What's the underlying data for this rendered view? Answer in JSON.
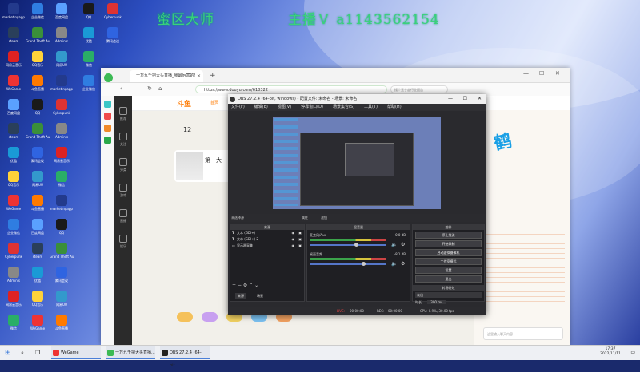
{
  "desktop": {
    "watermark_left": "蜜区大师",
    "watermark_right": "主播Ｖ a1143562154",
    "icons": [
      {
        "label": "marketingapp",
        "color": "#233a8c"
      },
      {
        "label": "企业微信",
        "color": "#2f7de1"
      },
      {
        "label": "百度网盘",
        "color": "#5aa0ff"
      },
      {
        "label": "QQ",
        "color": "#1a1a1a"
      },
      {
        "label": "Cyberpunk",
        "color": "#d33"
      },
      {
        "label": "steam",
        "color": "#2a3f5a"
      },
      {
        "label": "Grand Theft Auto V",
        "color": "#3a8f3a"
      },
      {
        "label": "Adminis",
        "color": "#888"
      },
      {
        "label": "优酷",
        "color": "#1a9ad6"
      },
      {
        "label": "腾讯会议",
        "color": "#2f64e1"
      },
      {
        "label": "网易云音乐",
        "color": "#d22"
      },
      {
        "label": "QQ音乐",
        "color": "#ffd23a"
      },
      {
        "label": "网易UU",
        "color": "#39c"
      },
      {
        "label": "微信",
        "color": "#2aae67"
      },
      {
        "label": "WeGame",
        "color": "#e33"
      },
      {
        "label": "斗鱼直播",
        "color": "#ff7a00"
      }
    ]
  },
  "browser": {
    "tab_title": "一万九千把大头直播_我最厉害的!",
    "url": "https://www.douyu.com/618322",
    "search_placeholder": "搜个元宇宙行业报告",
    "win_min": "—",
    "win_max": "☐",
    "win_close": "✕",
    "new_tab": "+",
    "nav_back": "‹",
    "nav_refresh": "↻",
    "nav_home": "⌂"
  },
  "douyu": {
    "logo": "斗鱼",
    "nav_home": "首页",
    "left_items": [
      "推荐",
      "关注",
      "分类",
      "游戏",
      "直播",
      "娱乐"
    ],
    "room_count": "12",
    "card_title": "第一大",
    "ad_text": "鹤",
    "chat_input": "这里输入聊天内容",
    "send": "发送"
  },
  "obs": {
    "title": "OBS 27.2.4 (64-bit, windows) - 配置文件: 未命名 - 场景: 未命名",
    "menu": [
      "文件(F)",
      "编辑(E)",
      "视图(V)",
      "停靠窗口(D)",
      "场景集合(S)",
      "工具(T)",
      "帮助(H)"
    ],
    "scene_label": "未选择源",
    "props_btn": "属性",
    "filter_btn": "滤镜",
    "sources_header": "来源",
    "sources": [
      {
        "tag": "T",
        "name": "文本 (GDI+)"
      },
      {
        "tag": "T",
        "name": "文本 (GDI+) 2"
      },
      {
        "tag": "▭",
        "name": "显示器采集"
      }
    ],
    "sources_tabs": [
      "来源",
      "场景"
    ],
    "mixer_header": "混音器",
    "mixer": [
      {
        "name": "麦克风/Aux",
        "db": "0.0 dB",
        "level": 0.6
      },
      {
        "name": "桌面音频",
        "db": "-8.1 dB",
        "level": 0.7
      }
    ],
    "controls_header": "控件",
    "controls": [
      "停止推流",
      "开始录制",
      "启动虚拟摄像机",
      "工作室模式",
      "设置",
      "退出"
    ],
    "transition_header": "转场特效",
    "transition_value": "淡出",
    "duration_label": "时长",
    "duration_value": "300 ms",
    "status": {
      "live_label": "LIVE:",
      "live_time": "00:00:00",
      "rec_label": "REC:",
      "rec_time": "00:00:00",
      "cpu": "CPU: 0.9%, 30.00 fps"
    }
  },
  "taskbar": {
    "apps": [
      {
        "label": "WeGame",
        "color": "#e33"
      },
      {
        "label": "一万九千把大头直播...",
        "color": "#3cba54"
      },
      {
        "label": "OBS 27.2.4 (64-bit...",
        "color": "#222"
      }
    ],
    "time": "17:37",
    "date": "2022/11/11"
  }
}
